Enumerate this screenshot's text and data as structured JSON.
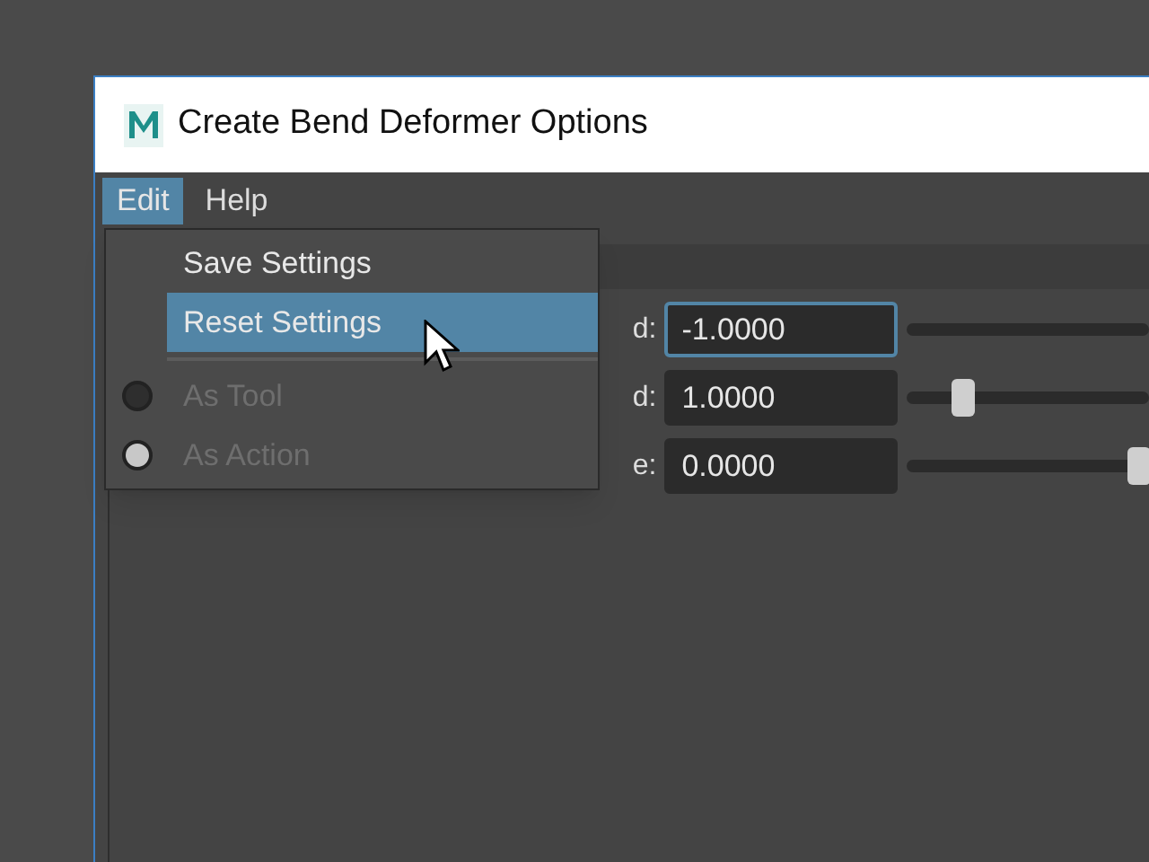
{
  "window": {
    "title": "Create Bend Deformer Options"
  },
  "menubar": [
    {
      "label": "Edit",
      "selected": true
    },
    {
      "label": "Help",
      "selected": false
    }
  ],
  "menu": [
    {
      "kind": "item",
      "label": "Save Settings",
      "selected": false,
      "disabled": false
    },
    {
      "kind": "item",
      "label": "Reset Settings",
      "selected": true,
      "disabled": false
    },
    {
      "kind": "separator"
    },
    {
      "kind": "radio",
      "label": "As Tool",
      "checked": false,
      "disabled": true
    },
    {
      "kind": "radio",
      "label": "As Action",
      "checked": true,
      "disabled": true
    }
  ],
  "fields": [
    {
      "label": "d:",
      "value": "-1.0000",
      "focused": true
    },
    {
      "label": "d:",
      "value": "1.0000",
      "focused": false,
      "level": 0.2
    },
    {
      "label": "e:",
      "value": "0.0000",
      "focused": false,
      "level": 1
    }
  ]
}
